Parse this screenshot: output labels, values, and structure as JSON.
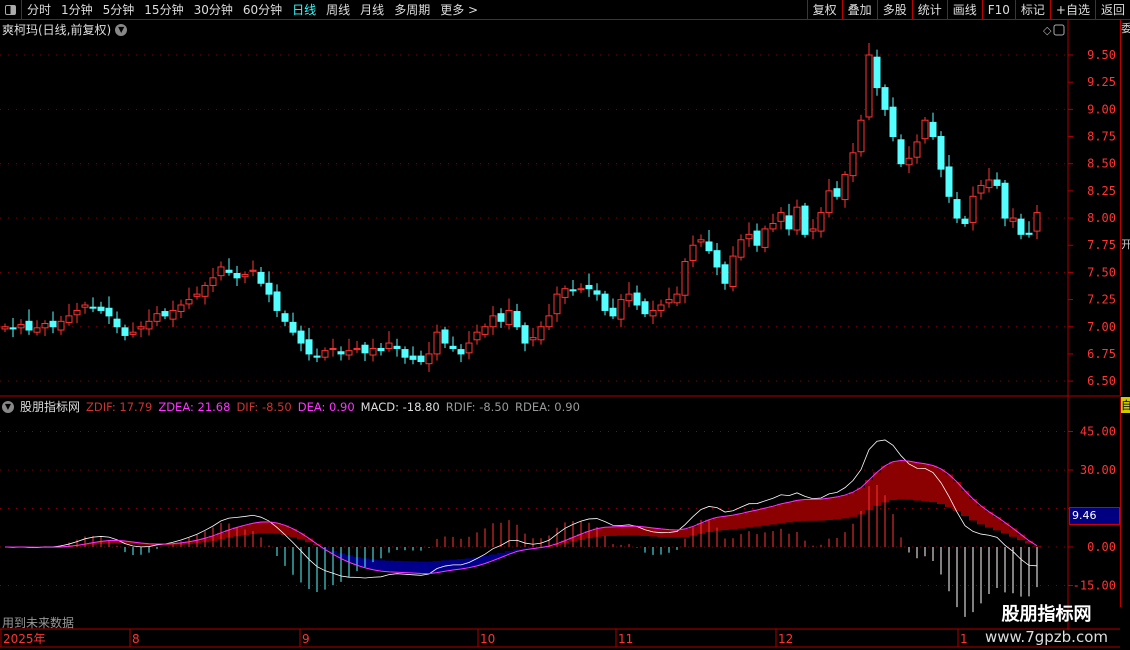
{
  "toolbar": {
    "periods": [
      "分时",
      "1分钟",
      "5分钟",
      "15分钟",
      "30分钟",
      "60分钟",
      "日线",
      "周线",
      "月线",
      "多周期",
      "更多 >"
    ],
    "active_period": "日线",
    "right_buttons": [
      "复权",
      "叠加",
      "多股",
      "统计",
      "画线",
      "F10",
      "标记",
      "+自选",
      "返回"
    ]
  },
  "stock": {
    "title": "爽柯玛(日线,前复权)"
  },
  "indicator": {
    "name": "股朋指标网",
    "zdif": "ZDIF: 17.79",
    "zdea": "ZDEA: 21.68",
    "dif": "DIF: -8.50",
    "dea": "DEA: 0.90",
    "macd": "MACD: -18.80",
    "rdif": "RDIF: -8.50",
    "rdea": "RDEA: 0.90",
    "highlight": "9.46",
    "future_note": "用到未来数据"
  },
  "watermark": {
    "line1": "股朋指标网",
    "line2": "www.7gpzb.com"
  },
  "right_strip": {
    "top": "委",
    "mid": "开",
    "bot": "自"
  },
  "colors": {
    "up": "#ff3333",
    "down": "#54ffff",
    "axis": "#ff3333",
    "grid": "#b00000",
    "dif": "#ffffff",
    "dea": "#ff33ff"
  },
  "chart_data": {
    "type": "candlestick",
    "price_axis": {
      "ticks": [
        9.5,
        9.25,
        9.0,
        8.75,
        8.5,
        8.25,
        8.0,
        7.75,
        7.5,
        7.25,
        7.0,
        6.75,
        6.5
      ],
      "labels": [
        "9.50",
        "9.25",
        "9.00",
        "8.75",
        "8.50",
        "8.25",
        "8.00",
        "7.75",
        "7.50",
        "7.25",
        "7.00",
        "6.75",
        "6.50"
      ]
    },
    "indicator_axis": {
      "ticks": [
        45,
        30,
        15,
        0,
        -15
      ],
      "labels": [
        "45.00",
        "30.00",
        "15.00",
        "0.00",
        "-15.00"
      ]
    },
    "time_axis": [
      "2025年",
      "8",
      "9",
      "10",
      "11",
      "12",
      "1"
    ],
    "closes": [
      7.0,
      6.98,
      7.02,
      6.97,
      6.99,
      7.03,
      7.0,
      7.05,
      7.1,
      7.15,
      7.2,
      7.18,
      7.15,
      7.1,
      7.0,
      6.92,
      6.95,
      7.0,
      7.05,
      7.12,
      7.1,
      7.15,
      7.2,
      7.25,
      7.3,
      7.38,
      7.45,
      7.55,
      7.5,
      7.45,
      7.48,
      7.52,
      7.4,
      7.3,
      7.15,
      7.05,
      6.95,
      6.85,
      6.75,
      6.72,
      6.78,
      6.8,
      6.75,
      6.78,
      6.8,
      6.76,
      6.8,
      6.78,
      6.85,
      6.8,
      6.72,
      6.7,
      6.68,
      6.75,
      6.95,
      6.85,
      6.8,
      6.75,
      6.85,
      6.95,
      7.0,
      7.1,
      7.05,
      7.15,
      7.0,
      6.85,
      6.9,
      7.0,
      7.1,
      7.3,
      7.35,
      7.33,
      7.35,
      7.35,
      7.3,
      7.15,
      7.1,
      7.25,
      7.3,
      7.2,
      7.12,
      7.15,
      7.2,
      7.25,
      7.3,
      7.6,
      7.75,
      7.8,
      7.7,
      7.55,
      7.4,
      7.65,
      7.8,
      7.85,
      7.75,
      7.9,
      7.95,
      8.05,
      7.9,
      8.1,
      7.85,
      7.9,
      8.05,
      8.25,
      8.2,
      8.4,
      8.6,
      8.9,
      9.5,
      9.2,
      9.0,
      8.75,
      8.5,
      8.55,
      8.7,
      8.9,
      8.75,
      8.45,
      8.2,
      8.0,
      7.95,
      8.2,
      8.3,
      8.35,
      8.3,
      8.0,
      8.0,
      7.85,
      7.85,
      8.05
    ]
  }
}
